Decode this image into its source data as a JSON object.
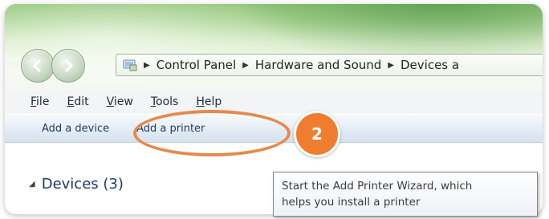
{
  "nav": {
    "back_icon": "back-arrow-icon",
    "forward_icon": "forward-arrow-icon"
  },
  "address_bar": {
    "icon": "control-panel-icon",
    "breadcrumbs": [
      "Control Panel",
      "Hardware and Sound",
      "Devices a"
    ]
  },
  "menu": {
    "items": [
      "File",
      "Edit",
      "View",
      "Tools",
      "Help"
    ]
  },
  "command_bar": {
    "add_device": "Add a device",
    "add_printer": "Add a printer"
  },
  "content": {
    "group_header": "Devices (3)"
  },
  "tooltip": {
    "line1": "Start the Add Printer Wizard, which",
    "line2": "helps you install a printer"
  },
  "annotation": {
    "step_number": "2",
    "color": "#f07d2e"
  }
}
